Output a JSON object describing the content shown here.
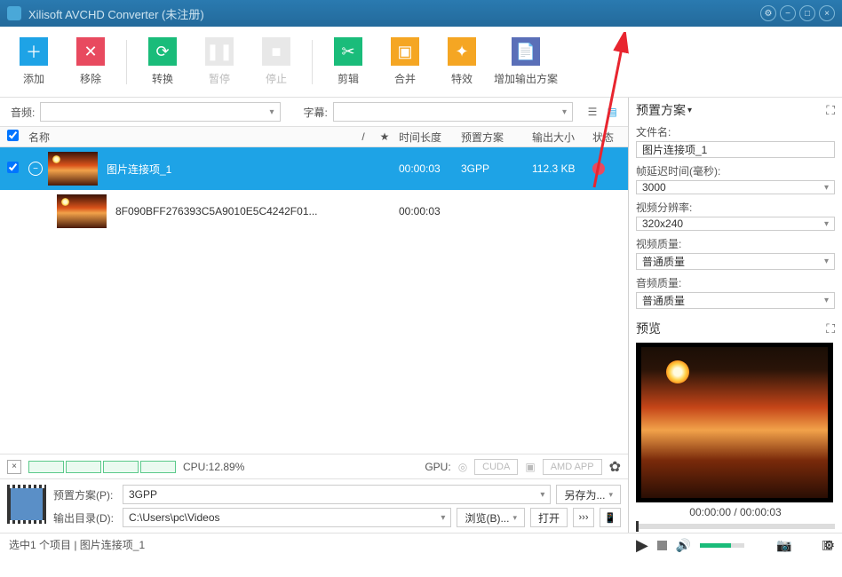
{
  "window": {
    "title": "Xilisoft AVCHD Converter (未注册)"
  },
  "toolbar": {
    "add": "添加",
    "remove": "移除",
    "convert": "转换",
    "pause": "暂停",
    "stop": "停止",
    "clip": "剪辑",
    "merge": "合并",
    "effects": "特效",
    "addProfile": "增加输出方案"
  },
  "dropdowns": {
    "audioLabel": "音频:",
    "subtitleLabel": "字幕:"
  },
  "tableHeaders": {
    "name": "名称",
    "duration": "时间长度",
    "preset": "预置方案",
    "outputSize": "输出大小",
    "status": "状态"
  },
  "rows": [
    {
      "name": "图片连接项_1",
      "duration": "00:00:03",
      "preset": "3GPP",
      "size": "112.3 KB"
    },
    {
      "name": "8F090BFF276393C5A9010E5C4242F01...",
      "duration": "00:00:03"
    }
  ],
  "cpu": {
    "label": "CPU:12.89%",
    "gpuLabel": "GPU:",
    "cuda": "CUDA",
    "amd": "AMD APP"
  },
  "output": {
    "presetLabel": "预置方案(P):",
    "presetValue": "3GPP",
    "saveAs": "另存为...",
    "dirLabel": "输出目录(D):",
    "dirValue": "C:\\Users\\pc\\Videos",
    "browse": "浏览(B)...",
    "open": "打开",
    "moveTo": "›››"
  },
  "status": {
    "text": "选中1 个项目 | 图片连接项_1"
  },
  "rightPanel": {
    "presetTitle": "预置方案",
    "filenameLabel": "文件名:",
    "filenameValue": "图片连接项_1",
    "frameDelayLabel": "帧延迟时间(毫秒):",
    "frameDelayValue": "3000",
    "resolutionLabel": "视频分辨率:",
    "resolutionValue": "320x240",
    "videoQualityLabel": "视频质量:",
    "videoQualityValue": "普通质量",
    "audioQualityLabel": "音频质量:",
    "audioQualityValue": "普通质量",
    "previewTitle": "预览",
    "timeText": "00:00:00 / 00:00:03"
  }
}
